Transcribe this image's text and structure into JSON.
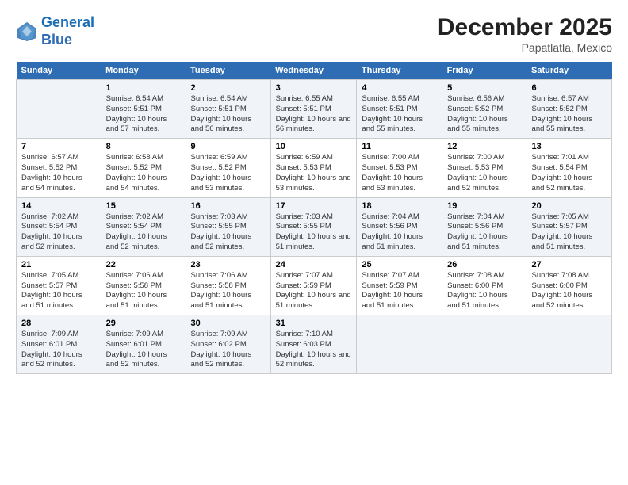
{
  "header": {
    "logo_line1": "General",
    "logo_line2": "Blue",
    "month_title": "December 2025",
    "location": "Papatlatla, Mexico"
  },
  "weekdays": [
    "Sunday",
    "Monday",
    "Tuesday",
    "Wednesday",
    "Thursday",
    "Friday",
    "Saturday"
  ],
  "weeks": [
    [
      {
        "day": "",
        "sunrise": "",
        "sunset": "",
        "daylight": ""
      },
      {
        "day": "1",
        "sunrise": "Sunrise: 6:54 AM",
        "sunset": "Sunset: 5:51 PM",
        "daylight": "Daylight: 10 hours and 57 minutes."
      },
      {
        "day": "2",
        "sunrise": "Sunrise: 6:54 AM",
        "sunset": "Sunset: 5:51 PM",
        "daylight": "Daylight: 10 hours and 56 minutes."
      },
      {
        "day": "3",
        "sunrise": "Sunrise: 6:55 AM",
        "sunset": "Sunset: 5:51 PM",
        "daylight": "Daylight: 10 hours and 56 minutes."
      },
      {
        "day": "4",
        "sunrise": "Sunrise: 6:55 AM",
        "sunset": "Sunset: 5:51 PM",
        "daylight": "Daylight: 10 hours and 55 minutes."
      },
      {
        "day": "5",
        "sunrise": "Sunrise: 6:56 AM",
        "sunset": "Sunset: 5:52 PM",
        "daylight": "Daylight: 10 hours and 55 minutes."
      },
      {
        "day": "6",
        "sunrise": "Sunrise: 6:57 AM",
        "sunset": "Sunset: 5:52 PM",
        "daylight": "Daylight: 10 hours and 55 minutes."
      }
    ],
    [
      {
        "day": "7",
        "sunrise": "Sunrise: 6:57 AM",
        "sunset": "Sunset: 5:52 PM",
        "daylight": "Daylight: 10 hours and 54 minutes."
      },
      {
        "day": "8",
        "sunrise": "Sunrise: 6:58 AM",
        "sunset": "Sunset: 5:52 PM",
        "daylight": "Daylight: 10 hours and 54 minutes."
      },
      {
        "day": "9",
        "sunrise": "Sunrise: 6:59 AM",
        "sunset": "Sunset: 5:52 PM",
        "daylight": "Daylight: 10 hours and 53 minutes."
      },
      {
        "day": "10",
        "sunrise": "Sunrise: 6:59 AM",
        "sunset": "Sunset: 5:53 PM",
        "daylight": "Daylight: 10 hours and 53 minutes."
      },
      {
        "day": "11",
        "sunrise": "Sunrise: 7:00 AM",
        "sunset": "Sunset: 5:53 PM",
        "daylight": "Daylight: 10 hours and 53 minutes."
      },
      {
        "day": "12",
        "sunrise": "Sunrise: 7:00 AM",
        "sunset": "Sunset: 5:53 PM",
        "daylight": "Daylight: 10 hours and 52 minutes."
      },
      {
        "day": "13",
        "sunrise": "Sunrise: 7:01 AM",
        "sunset": "Sunset: 5:54 PM",
        "daylight": "Daylight: 10 hours and 52 minutes."
      }
    ],
    [
      {
        "day": "14",
        "sunrise": "Sunrise: 7:02 AM",
        "sunset": "Sunset: 5:54 PM",
        "daylight": "Daylight: 10 hours and 52 minutes."
      },
      {
        "day": "15",
        "sunrise": "Sunrise: 7:02 AM",
        "sunset": "Sunset: 5:54 PM",
        "daylight": "Daylight: 10 hours and 52 minutes."
      },
      {
        "day": "16",
        "sunrise": "Sunrise: 7:03 AM",
        "sunset": "Sunset: 5:55 PM",
        "daylight": "Daylight: 10 hours and 52 minutes."
      },
      {
        "day": "17",
        "sunrise": "Sunrise: 7:03 AM",
        "sunset": "Sunset: 5:55 PM",
        "daylight": "Daylight: 10 hours and 51 minutes."
      },
      {
        "day": "18",
        "sunrise": "Sunrise: 7:04 AM",
        "sunset": "Sunset: 5:56 PM",
        "daylight": "Daylight: 10 hours and 51 minutes."
      },
      {
        "day": "19",
        "sunrise": "Sunrise: 7:04 AM",
        "sunset": "Sunset: 5:56 PM",
        "daylight": "Daylight: 10 hours and 51 minutes."
      },
      {
        "day": "20",
        "sunrise": "Sunrise: 7:05 AM",
        "sunset": "Sunset: 5:57 PM",
        "daylight": "Daylight: 10 hours and 51 minutes."
      }
    ],
    [
      {
        "day": "21",
        "sunrise": "Sunrise: 7:05 AM",
        "sunset": "Sunset: 5:57 PM",
        "daylight": "Daylight: 10 hours and 51 minutes."
      },
      {
        "day": "22",
        "sunrise": "Sunrise: 7:06 AM",
        "sunset": "Sunset: 5:58 PM",
        "daylight": "Daylight: 10 hours and 51 minutes."
      },
      {
        "day": "23",
        "sunrise": "Sunrise: 7:06 AM",
        "sunset": "Sunset: 5:58 PM",
        "daylight": "Daylight: 10 hours and 51 minutes."
      },
      {
        "day": "24",
        "sunrise": "Sunrise: 7:07 AM",
        "sunset": "Sunset: 5:59 PM",
        "daylight": "Daylight: 10 hours and 51 minutes."
      },
      {
        "day": "25",
        "sunrise": "Sunrise: 7:07 AM",
        "sunset": "Sunset: 5:59 PM",
        "daylight": "Daylight: 10 hours and 51 minutes."
      },
      {
        "day": "26",
        "sunrise": "Sunrise: 7:08 AM",
        "sunset": "Sunset: 6:00 PM",
        "daylight": "Daylight: 10 hours and 51 minutes."
      },
      {
        "day": "27",
        "sunrise": "Sunrise: 7:08 AM",
        "sunset": "Sunset: 6:00 PM",
        "daylight": "Daylight: 10 hours and 52 minutes."
      }
    ],
    [
      {
        "day": "28",
        "sunrise": "Sunrise: 7:09 AM",
        "sunset": "Sunset: 6:01 PM",
        "daylight": "Daylight: 10 hours and 52 minutes."
      },
      {
        "day": "29",
        "sunrise": "Sunrise: 7:09 AM",
        "sunset": "Sunset: 6:01 PM",
        "daylight": "Daylight: 10 hours and 52 minutes."
      },
      {
        "day": "30",
        "sunrise": "Sunrise: 7:09 AM",
        "sunset": "Sunset: 6:02 PM",
        "daylight": "Daylight: 10 hours and 52 minutes."
      },
      {
        "day": "31",
        "sunrise": "Sunrise: 7:10 AM",
        "sunset": "Sunset: 6:03 PM",
        "daylight": "Daylight: 10 hours and 52 minutes."
      },
      {
        "day": "",
        "sunrise": "",
        "sunset": "",
        "daylight": ""
      },
      {
        "day": "",
        "sunrise": "",
        "sunset": "",
        "daylight": ""
      },
      {
        "day": "",
        "sunrise": "",
        "sunset": "",
        "daylight": ""
      }
    ]
  ]
}
